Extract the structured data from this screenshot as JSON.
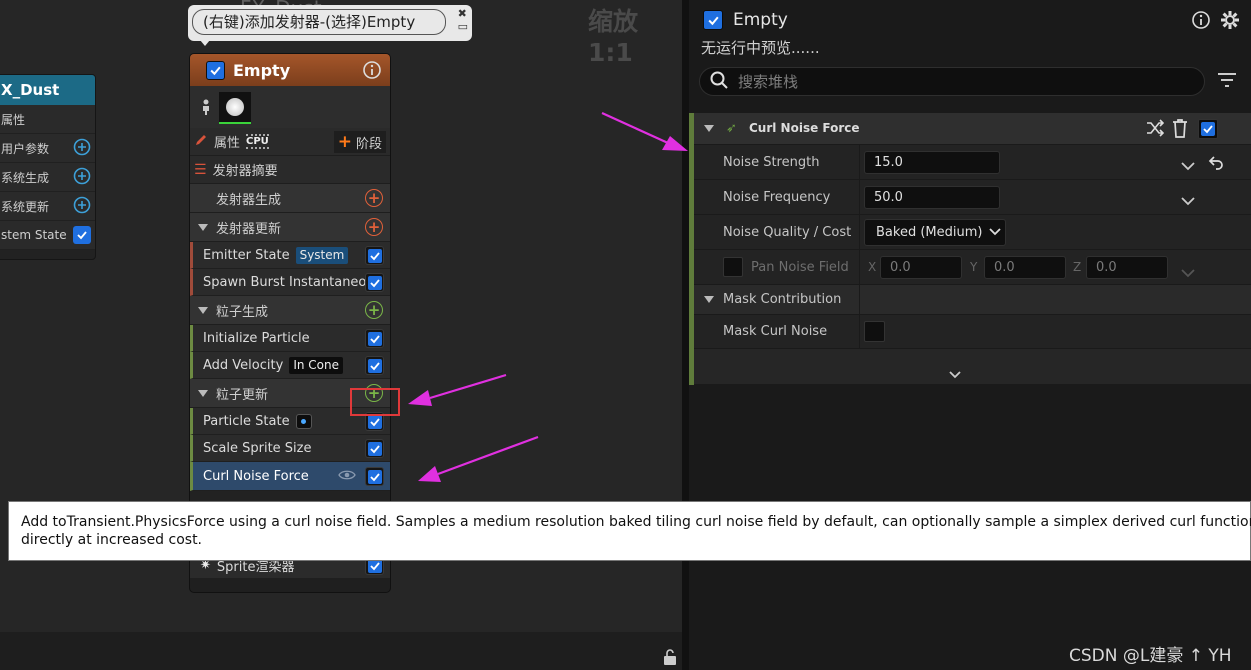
{
  "graph": {
    "title": "FX_Dust",
    "zoom": "缩放1:1",
    "left_node": {
      "title": "X_Dust",
      "rows": [
        "属性",
        "用户参数",
        "系统生成",
        "系统更新",
        "stem State"
      ]
    },
    "comment": "(右键)添加发射器-(选择)Empty",
    "emitter": {
      "title": "Empty",
      "props_label": "属性",
      "sim_target": "CPU",
      "stage_label": "阶段",
      "summary": "发射器摘要",
      "sections": {
        "emitter_spawn": "发射器生成",
        "emitter_update": "发射器更新",
        "particle_spawn": "粒子生成",
        "particle_update": "粒子更新"
      },
      "modules": {
        "emitter_state": "Emitter State",
        "emitter_state_badge": "System",
        "spawn_burst": "Spawn Burst Instantaneous",
        "init_particle": "Initialize Particle",
        "add_velocity": "Add Velocity",
        "add_velocity_badge": "In Cone",
        "particle_state": "Particle State",
        "scale_sprite": "Scale Sprite Size",
        "curl_noise": "Curl Noise Force",
        "sprite_renderer": "Sprite渲染器"
      }
    }
  },
  "tooltip": {
    "line1": "Add toTransient.PhysicsForce using a curl noise field. Samples a medium resolution baked tiling curl noise field by default, can optionally sample a simplex derived curl function",
    "line2": "directly at increased cost."
  },
  "details": {
    "title": "Empty",
    "subtitle": "无运行中预览......",
    "search_placeholder": "搜索堆栈",
    "module_title": "Curl Noise Force",
    "noise_strength_label": "Noise Strength",
    "noise_strength_value": "15.0",
    "noise_frequency_label": "Noise Frequency",
    "noise_frequency_value": "50.0",
    "noise_quality_label": "Noise Quality / Cost",
    "noise_quality_value": "Baked (Medium)",
    "pan_noise_label": "Pan Noise Field",
    "pan_x_label": "X",
    "pan_x": "0.0",
    "pan_y_label": "Y",
    "pan_y": "0.0",
    "pan_z_label": "Z",
    "pan_z": "0.0",
    "mask_section": "Mask Contribution",
    "mask_curl_label": "Mask Curl Noise"
  },
  "watermark": "CSDN @L建豪 ↑ YH",
  "colors": {
    "checkbox_blue": "#1f6fe0",
    "emitter_header": "#9a4e24",
    "module_selected": "#2e4a6b",
    "annotation_arrow": "#e030e0",
    "annotation_box": "#e0393a"
  }
}
